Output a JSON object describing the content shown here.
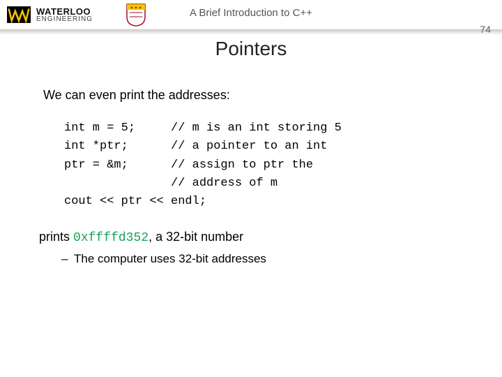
{
  "header": {
    "logo_top": "WATERLOO",
    "logo_bottom": "ENGINEERING",
    "course_title": "A Brief Introduction to C++",
    "page_number": "74"
  },
  "title": "Pointers",
  "lead": "We can even print the addresses:",
  "code": "int m = 5;     // m is an int storing 5\nint *ptr;      // a pointer to an int\nptr = &m;      // assign to ptr the\n               // address of m\ncout << ptr << endl;",
  "result_prefix": "prints ",
  "result_hex": "0xffffd352",
  "result_suffix": ", a 32-bit number",
  "bullet": "The computer uses 32-bit addresses"
}
